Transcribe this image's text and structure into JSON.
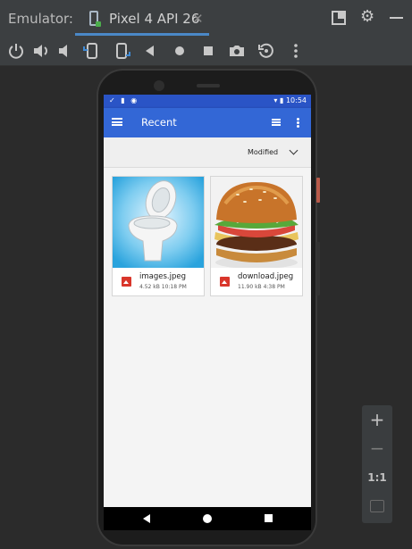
{
  "window": {
    "title": "Emulator:",
    "tab_label": "Pixel 4 API 26",
    "tab_close": "✕"
  },
  "zoom": {
    "zoom_in": "+",
    "zoom_out": "−",
    "actual_size": "1:1"
  },
  "device": {
    "status_time": "10:54",
    "appbar_title": "Recent",
    "sort_label": "Modified",
    "files": [
      {
        "name": "images.jpeg",
        "meta": "4.52 kB 10:18 PM"
      },
      {
        "name": "download.jpeg",
        "meta": "11.90 kB 4:38 PM"
      }
    ]
  },
  "colors": {
    "appbar": "#3367d6",
    "statusbar": "#2a54c6",
    "ide_bg": "#2b2b2b",
    "tab_accent": "#4a88c7"
  }
}
